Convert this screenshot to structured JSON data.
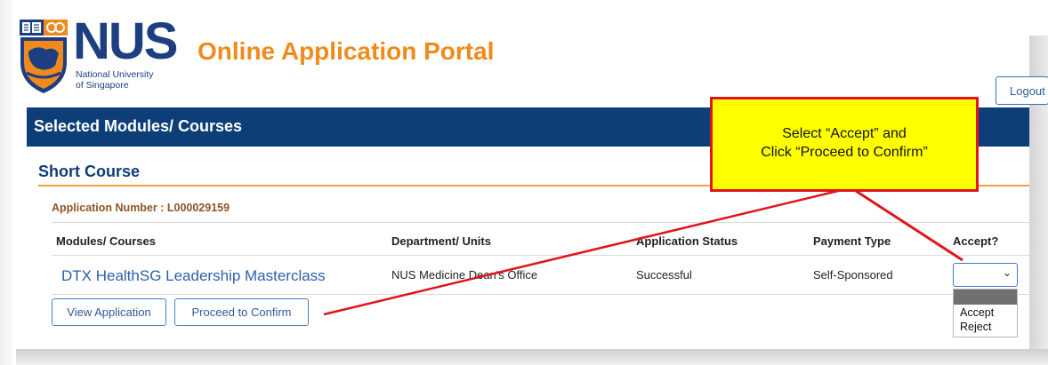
{
  "header": {
    "logo_word": "NUS",
    "logo_subtitle_line1": "National University",
    "logo_subtitle_line2": "of Singapore",
    "portal_title": "Online Application Portal",
    "logout_label": "Logout"
  },
  "section": {
    "title": "Selected Modules/ Courses",
    "subtitle": "Short Course",
    "application_number": "Application Number : L000029159"
  },
  "table": {
    "headers": [
      "Modules/ Courses",
      "Department/ Units",
      "Application Status",
      "Payment Type",
      "Accept?"
    ],
    "rows": [
      {
        "course": "DTX HealthSG Leadership Masterclass",
        "department": "NUS Medicine Dean's Office",
        "status": "Successful",
        "payment": "Self-Sponsored",
        "accept_value": ""
      }
    ]
  },
  "accept_dropdown": {
    "options": [
      "",
      "Accept",
      "Reject"
    ],
    "highlighted_index": 0
  },
  "buttons": {
    "view_application": "View Application",
    "proceed_to_confirm": "Proceed to Confirm"
  },
  "annotation": {
    "line1": "Select “Accept” and",
    "line2": "Click “Proceed to Confirm”",
    "fill_color": "#ffff00",
    "border_color": "#e0141b"
  },
  "colors": {
    "nav_blue": "#0d3e78",
    "accent_orange": "#f08a1c",
    "link_blue": "#2c5fa8",
    "app_number_brown": "#8e5427"
  }
}
